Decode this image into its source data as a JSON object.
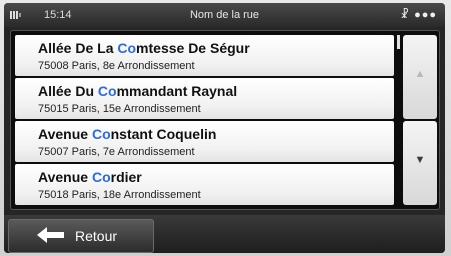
{
  "status": {
    "time": "15:14",
    "title": "Nom de la rue",
    "icons": "☧ ●●●"
  },
  "results": [
    {
      "prefix": "Allée De La ",
      "match": "Co",
      "suffix": "mtesse De Ségur",
      "address": "75008 Paris, 8e Arrondissement"
    },
    {
      "prefix": "Allée Du ",
      "match": "Co",
      "suffix": "mmandant Raynal",
      "address": "75015 Paris, 15e Arrondissement"
    },
    {
      "prefix": "Avenue ",
      "match": "Co",
      "suffix": "nstant Coquelin",
      "address": "75007 Paris, 7e Arrondissement"
    },
    {
      "prefix": "Avenue ",
      "match": "Co",
      "suffix": "rdier",
      "address": "75018 Paris, 18e Arrondissement"
    }
  ],
  "scroll": {
    "up_glyph": "▲",
    "down_glyph": "▼"
  },
  "bottom": {
    "back_label": "Retour"
  },
  "colors": {
    "highlight": "#2a6be0"
  }
}
